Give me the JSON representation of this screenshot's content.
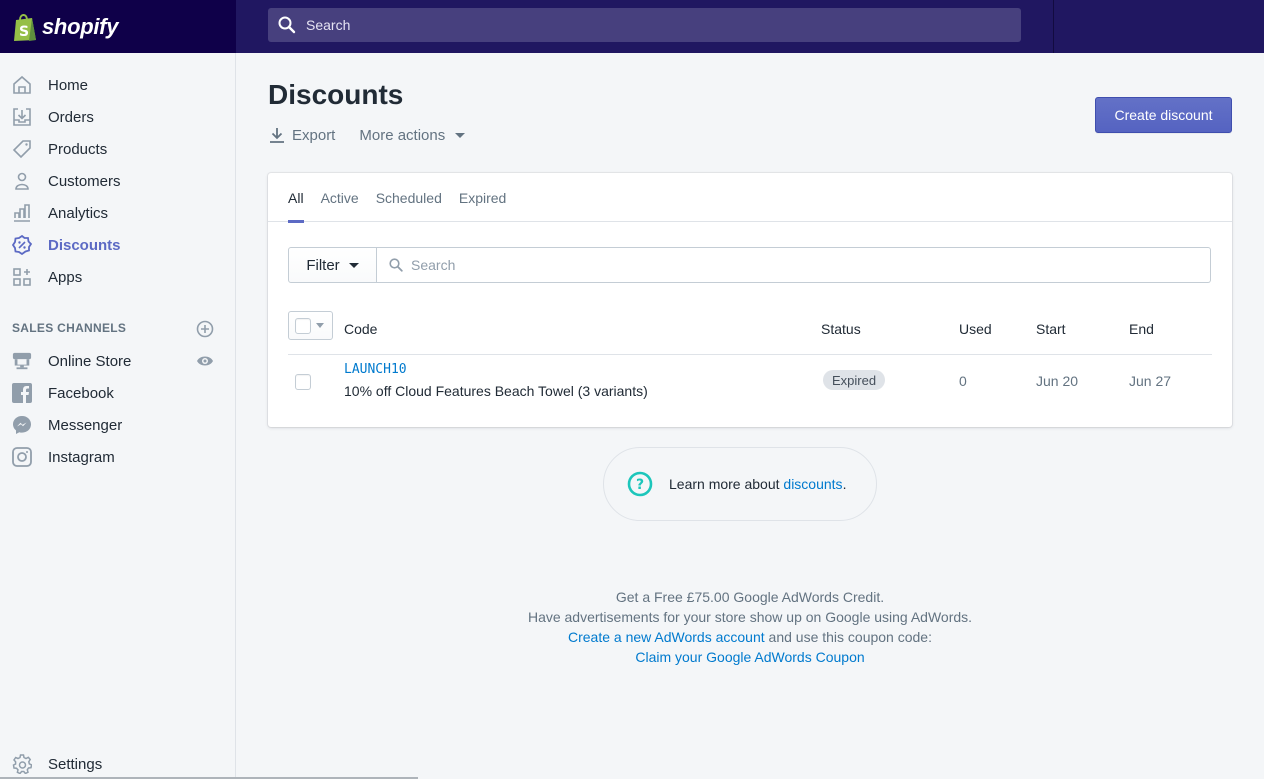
{
  "brand": {
    "name": "shopify",
    "logo_color": "#95bf47",
    "topbar_color": "#201761"
  },
  "topbar": {
    "search_placeholder": "Search"
  },
  "sidebar": {
    "items": [
      {
        "label": "Home",
        "icon": "home-icon"
      },
      {
        "label": "Orders",
        "icon": "orders-icon"
      },
      {
        "label": "Products",
        "icon": "tag-icon"
      },
      {
        "label": "Customers",
        "icon": "person-icon"
      },
      {
        "label": "Analytics",
        "icon": "bar-chart-icon"
      },
      {
        "label": "Discounts",
        "icon": "discount-icon",
        "active": true
      },
      {
        "label": "Apps",
        "icon": "apps-icon"
      }
    ],
    "sales_channels_title": "SALES CHANNELS",
    "channels": [
      {
        "label": "Online Store",
        "icon": "store-icon"
      },
      {
        "label": "Facebook",
        "icon": "facebook-icon"
      },
      {
        "label": "Messenger",
        "icon": "messenger-icon"
      },
      {
        "label": "Instagram",
        "icon": "instagram-icon"
      }
    ],
    "settings_label": "Settings",
    "accent_color": "#5c6ac4"
  },
  "page": {
    "title": "Discounts",
    "export_label": "Export",
    "more_actions_label": "More actions",
    "create_button": "Create discount"
  },
  "tabs": [
    {
      "label": "All",
      "active": true
    },
    {
      "label": "Active"
    },
    {
      "label": "Scheduled"
    },
    {
      "label": "Expired"
    }
  ],
  "filter": {
    "button_label": "Filter",
    "search_placeholder": "Search"
  },
  "table": {
    "columns": [
      "Code",
      "Status",
      "Used",
      "Start",
      "End"
    ],
    "rows": [
      {
        "code": "LAUNCH10",
        "description": "10% off Cloud Features Beach Towel (3 variants)",
        "status": "Expired",
        "used": "0",
        "start": "Jun 20",
        "end": "Jun 27"
      }
    ]
  },
  "help": {
    "text": "Learn more about ",
    "link": "discounts",
    "suffix": "."
  },
  "promo": {
    "line1": "Get a Free £75.00 Google AdWords Credit.",
    "line2": "Have advertisements for your store show up on Google using AdWords.",
    "line3_link": "Create a new AdWords account",
    "line3_text": " and use this coupon code:",
    "line4_link": "Claim your Google AdWords Coupon"
  }
}
